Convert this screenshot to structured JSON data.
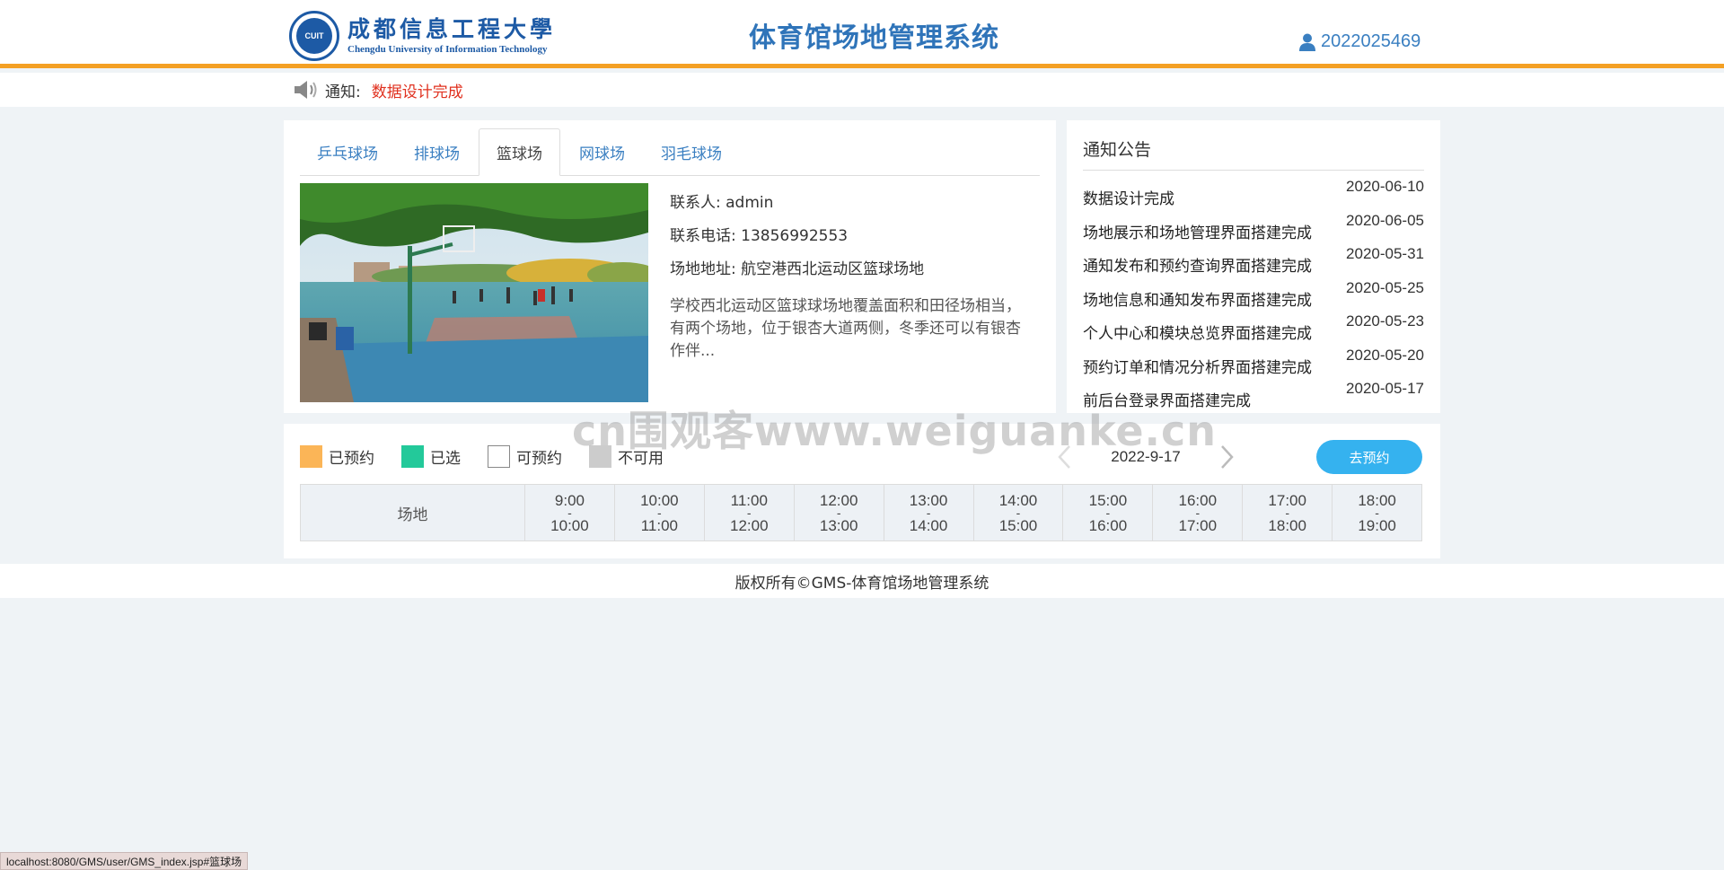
{
  "header": {
    "logo": {
      "seal_text": "CUIT",
      "cn_name": "成都信息工程大學",
      "en_name": "Chengdu University of Information Technology"
    },
    "system_title": "体育馆场地管理系统",
    "user_id": "2022025469",
    "user_icon": "user-icon"
  },
  "notice_bar": {
    "icon": "speaker-icon",
    "label": "通知:",
    "message": "数据设计完成"
  },
  "venue": {
    "tabs": [
      {
        "label": "乒乓球场",
        "active": false
      },
      {
        "label": "排球场",
        "active": false
      },
      {
        "label": "篮球场",
        "active": true
      },
      {
        "label": "网球场",
        "active": false
      },
      {
        "label": "羽毛球场",
        "active": false
      }
    ],
    "contact": "联系人: admin",
    "phone": "联系电话: 13856992553",
    "address": "场地地址: 航空港西北运动区篮球场地",
    "description": "学校西北运动区篮球球场地覆盖面积和田径场相当，有两个场地，位于银杏大道两侧，冬季还可以有银杏作伴..."
  },
  "board": {
    "title": "通知公告",
    "items": [
      {
        "title": "数据设计完成",
        "date": "2020-06-10"
      },
      {
        "title": "场地展示和场地管理界面搭建完成",
        "date": "2020-06-05"
      },
      {
        "title": "通知发布和预约查询界面搭建完成",
        "date": "2020-05-31"
      },
      {
        "title": "场地信息和通知发布界面搭建完成",
        "date": "2020-05-25"
      },
      {
        "title": "个人中心和模块总览界面搭建完成",
        "date": "2020-05-23"
      },
      {
        "title": "预约订单和情况分析界面搭建完成",
        "date": "2020-05-20"
      },
      {
        "title": "前后台登录界面搭建完成",
        "date": "2020-05-17"
      }
    ]
  },
  "schedule": {
    "legend": [
      {
        "label": "已预约",
        "color": "#fbb557"
      },
      {
        "label": "已选",
        "color": "#23c99a"
      },
      {
        "label": "可预约",
        "color": "#ffffff"
      },
      {
        "label": "不可用",
        "color": "#cccccc"
      }
    ],
    "date": "2022-9-17",
    "book_button": "去预约",
    "venue_header": "场地",
    "slots": [
      {
        "start": "9:00",
        "sep": "-",
        "end": "10:00"
      },
      {
        "start": "10:00",
        "sep": "-",
        "end": "11:00"
      },
      {
        "start": "11:00",
        "sep": "-",
        "end": "12:00"
      },
      {
        "start": "12:00",
        "sep": "-",
        "end": "13:00"
      },
      {
        "start": "13:00",
        "sep": "-",
        "end": "14:00"
      },
      {
        "start": "14:00",
        "sep": "-",
        "end": "15:00"
      },
      {
        "start": "15:00",
        "sep": "-",
        "end": "16:00"
      },
      {
        "start": "16:00",
        "sep": "-",
        "end": "17:00"
      },
      {
        "start": "17:00",
        "sep": "-",
        "end": "18:00"
      },
      {
        "start": "18:00",
        "sep": "-",
        "end": "19:00"
      }
    ]
  },
  "footer": {
    "copyright": "版权所有©GMS-体育馆场地管理系统"
  },
  "watermark": "cn围观客www.weiguanke.cn",
  "statusbar": {
    "url": "localhost:8080/GMS/user/GMS_index.jsp#篮球场"
  },
  "colors": {
    "accent_orange": "#f4a024",
    "brand_blue": "#2f74b9",
    "notice_red": "#e0301e",
    "button_blue": "#35b2ef"
  }
}
